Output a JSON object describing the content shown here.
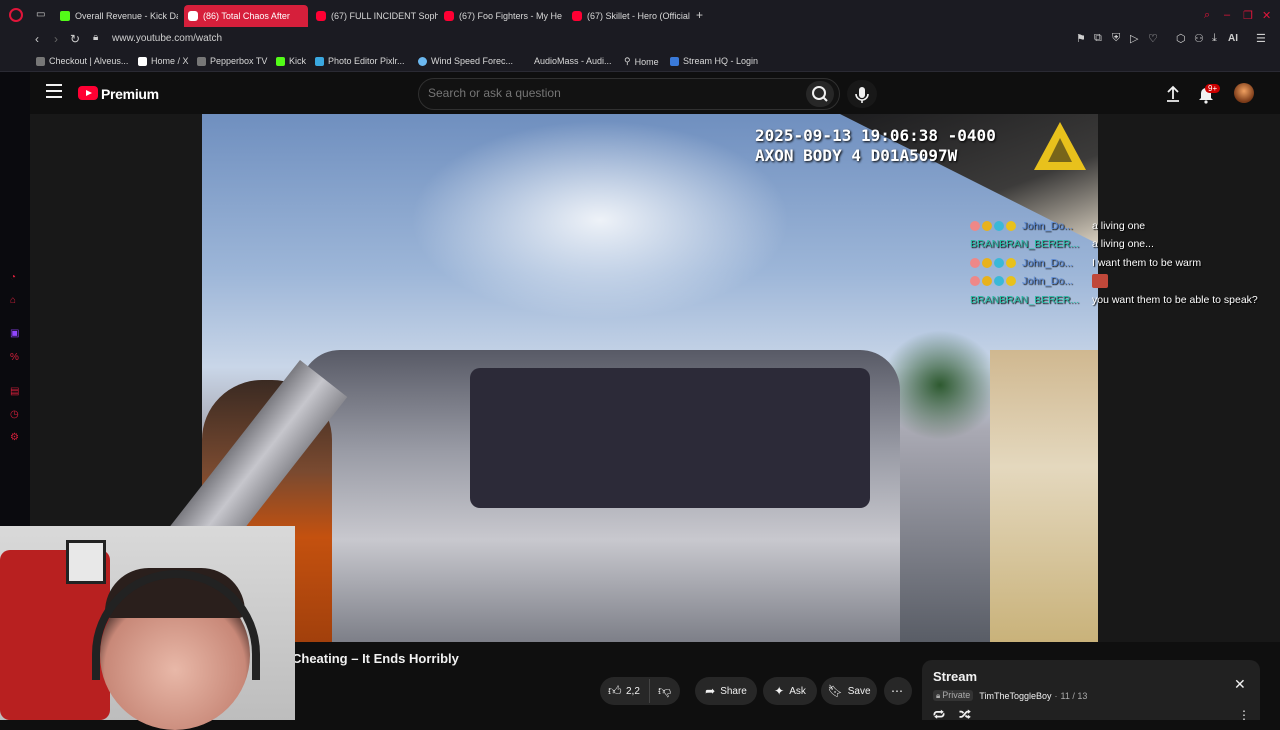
{
  "browser": {
    "tabs": [
      {
        "label": "Overall Revenue - Kick Da",
        "icon": "kick"
      },
      {
        "label": "(86) Total Chaos After",
        "icon": "youtube",
        "active": true
      },
      {
        "label": "(67) FULL INCIDENT Soph",
        "icon": "youtube"
      },
      {
        "label": "(67) Foo Fighters - My Her",
        "icon": "youtube"
      },
      {
        "label": "(67) Skillet - Hero (Official",
        "icon": "youtube"
      }
    ],
    "new_tab": "+",
    "url": "www.youtube.com/watch",
    "bookmarks": [
      "Checkout | Alveus...",
      "Home / X",
      "Pepperbox TV",
      "Kick",
      "Photo Editor Pixlr...",
      "Wind Speed Forec...",
      "AudioMass - Audi...",
      "Home",
      "Stream HQ - Login"
    ],
    "address_bar_ai": "AI"
  },
  "youtube": {
    "brand": "Premium",
    "search_placeholder": "Search or ask a question",
    "notifications_badge": "9+"
  },
  "video": {
    "bodycam_overlay": "2025-09-13 19:06:38 -0400\nAXON BODY 4 D01A5097W",
    "title_visible": "Cheating – It Ends Horribly",
    "like_count": "2,2",
    "actions": {
      "share": "Share",
      "ask": "Ask",
      "save": "Save"
    }
  },
  "chat": [
    {
      "user": "John_Do...",
      "color": "blue",
      "message": "a living one"
    },
    {
      "user": "BRANBRAN_BERER...",
      "color": "teal",
      "message": "a living one..."
    },
    {
      "user": "John_Do...",
      "color": "blue",
      "message": "I want them to be warm"
    },
    {
      "user": "John_Do...",
      "color": "blue",
      "message": ""
    },
    {
      "user": "BRANBRAN_BERER...",
      "color": "teal",
      "message": "you want them to be able to speak?"
    }
  ],
  "playlist": {
    "title": "Stream",
    "privacy": "Private",
    "owner": "TimTheToggleBoy",
    "position": "11 / 13"
  }
}
